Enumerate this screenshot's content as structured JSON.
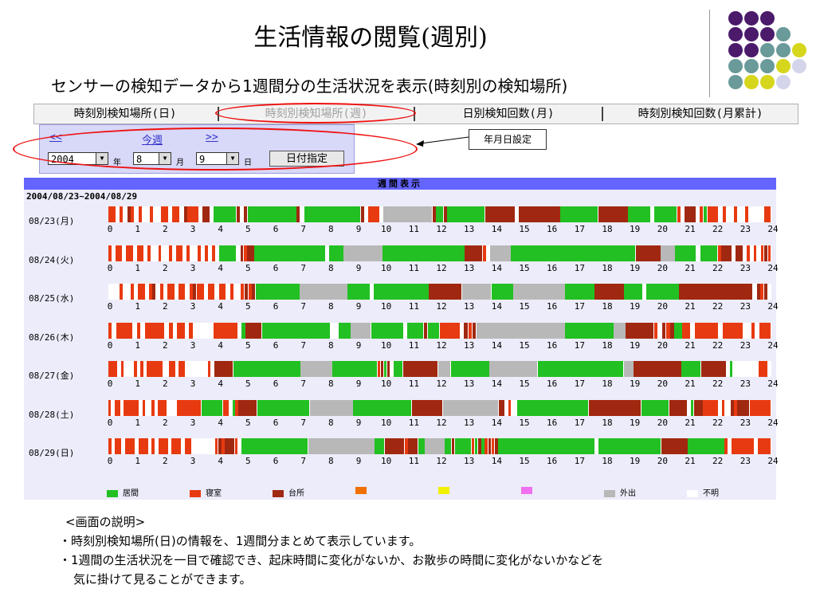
{
  "slide_title": "生活情報の閲覧(週別)",
  "subtitle": "センサーの検知データから1週間分の生活状況を表示(時刻別の検知場所)",
  "colors": {
    "living": "#22c022",
    "bedroom": "#e83a10",
    "kitchen": "#a02810",
    "orange": "#f07000",
    "yellow": "#f0f000",
    "pink": "#f070f0",
    "out": "#b8b8b8",
    "unknown": "#ffffff",
    "header": "#6464ff",
    "dot_purple": "#4b1a6b",
    "dot_teal": "#6a9a9a",
    "dot_lime": "#d6d61c",
    "dot_lavender": "#d4d4ea"
  },
  "tabs": [
    {
      "label": "時刻別検知場所(日)",
      "active": false
    },
    {
      "label": "時刻別検知場所(週)",
      "active": true
    },
    {
      "label": "日別検知回数(月)",
      "active": false
    },
    {
      "label": "時刻別検知回数(月累計)",
      "active": false
    }
  ],
  "date_controls": {
    "prev": "<<",
    "this_week": "今週",
    "next": ">>",
    "year": "2004",
    "year_unit": "年",
    "month": "8",
    "month_unit": "月",
    "day": "9",
    "day_unit": "日",
    "date_button": "日付指定",
    "callout": "年月日設定"
  },
  "week_header": "週間表示",
  "week_range": "2004/08/23~2004/08/29",
  "hour_labels": [
    "0",
    "1",
    "2",
    "3",
    "4",
    "5",
    "6",
    "7",
    "8",
    "9",
    "10",
    "11",
    "12",
    "13",
    "14",
    "15",
    "16",
    "17",
    "18",
    "19",
    "20",
    "21",
    "22",
    "23",
    "24"
  ],
  "days": [
    {
      "label": "08/23(月)",
      "pattern": "BBWBWKBWBWWBWWBBWBBWKBBBWKKWLLLLLLKWKLLLLLLLLLLLLLKWLLLLLLLLLLLLLLLKWBBBWOOOOOOOOOOOOOKLLKLLLLLLLLLLKKKKKKKKWKKKKKKKKKKKLLLLLLLLLLKKKKKKKKLLLLLLWLLLLLLBWKKKWBLBBBWBWWBWWBWWWWBB"
    },
    {
      "label": "08/24(火)",
      "pattern": "BWBBWBBWBBWBWWBWWBWBBWBWWBWBWBWLLLLLWKBKKLLLLLLLLLLLLLLLLLLLLWLLLLOOOOOOOOOOOLLLLLLLLLLLLLLLLLLLLLLLKKKKKBWOOOOOOLLLLLLLLLLLLLLLLLLLLLLLLLLLLLLLLLLLKKKKKKKOOOOLLLLLLWLLLLLBKKKWKKWBWBWBKB"
    },
    {
      "label": "08/25(水)",
      "pattern": "WWWBWWBWBBWBKWBWBBWBBWBKBBWBBWBBWBWWBKBKLLLLLLLLLLLLOOOOOOOOOOOOOLLLLLLWLLLLLLLLLLLLLLLKKKKKKKKKOOOOOOOOLLLLLLOOOOOOOOOOOOOOLLLLLLLLKKKKKKKKLLLLLWLLLLLLLLLKKKKKKKKKKKKKKKKKKKKWKBKW"
    },
    {
      "label": "08/26(木)",
      "pattern": "BWBBBBWBWBBBBBWBWBBWBWWWWWBBBBBBWLKKKKLLLLLLLLLLLLLLLLLWWLLLOOOOOLLLLLLLLWLLLLKLLLBBBBBWKBKOOOOOOOOOOOOOOOOOOOOOOLLLLLLLLLLLLOOOKKKKKKKBWKBKLLBBWBBBBBBWBBBBBWWBWBBB"
    },
    {
      "label": "08/27(金)",
      "pattern": "BBBWBWWWBWBWBBBBBWWBBWBBWWWWWWWBWKKKKKKLLLLLLLLLLLLLLLLLLLLLOOOOOOOOOOLLLLLLLLLLLLLLBKLKWLLLKKKKKKKKKKKOOOOLLLLLLLLLLLLOOOOOOOOOOOOOOOLLLLLLLLLLLLLLLLLLLLLLLLLLLOOOKKKKKKKKKKKKKKKLLLLLLKKKKKKKKWLWWWWWWWWBBBW"
    },
    {
      "label": "08/28(土)",
      "pattern": "BWBBWBBBBBWBWWBWBBBWWWBBBBBBBBLLLLLLLBBWLBKKKKKKLLLLLLLLLLLLLLLLLOOOOOOOOOOOOOOLLLLLLLLLLLLLLLLLLLKKKKKKKKKKOOOOOOOOOOOOOOOOOOKKWBWWLLLLLLLLLLLLLLLLLLLLLLLKKKKKKKKKKKKKKKKKLLLLLLLLLKKKKKKWLKKKBBBBBWBWWKBKKKKBBBBBBB"
    },
    {
      "label": "08/29(日)",
      "pattern": "BWBBWBBBWBBBWBWBBBWBBBWBBWWWWWWWBKBKKKBWLLLLLLLLLLLLLLLLLLLLOOOOOOOOOOOOOOOOOOOOLLLKKKKKKBKKKLLOOOOOOLLKLLLLLBLKLBKBKLLLLLLLLLLLLLLLLLLLLLLLLLLLLLWLLLLLLLLLLLLLLLLLLLKKKKKKKKLLLLLLLLLLLBWBBBBBBBWBBBB"
    }
  ],
  "legend": [
    {
      "label": "居間",
      "color": "#22c022"
    },
    {
      "label": "寝室",
      "color": "#e83a10"
    },
    {
      "label": "台所",
      "color": "#a02810"
    },
    {
      "label": "",
      "color": "#f07000"
    },
    {
      "label": "",
      "color": "#f0f000"
    },
    {
      "label": "",
      "color": "#f070f0"
    },
    {
      "label": "外出",
      "color": "#b8b8b8"
    },
    {
      "label": "不明",
      "color": "#ffffff"
    }
  ],
  "notes": {
    "heading": "<画面の説明>",
    "line1": "・時刻別検知場所(日)の情報を、1週間分まとめて表示しています。",
    "line2": "・1週間の生活状況を一目で確認でき、起床時間に変化がないか、お散歩の時間に変化がないかなどを",
    "line3": "気に掛けて見ることができます。"
  }
}
